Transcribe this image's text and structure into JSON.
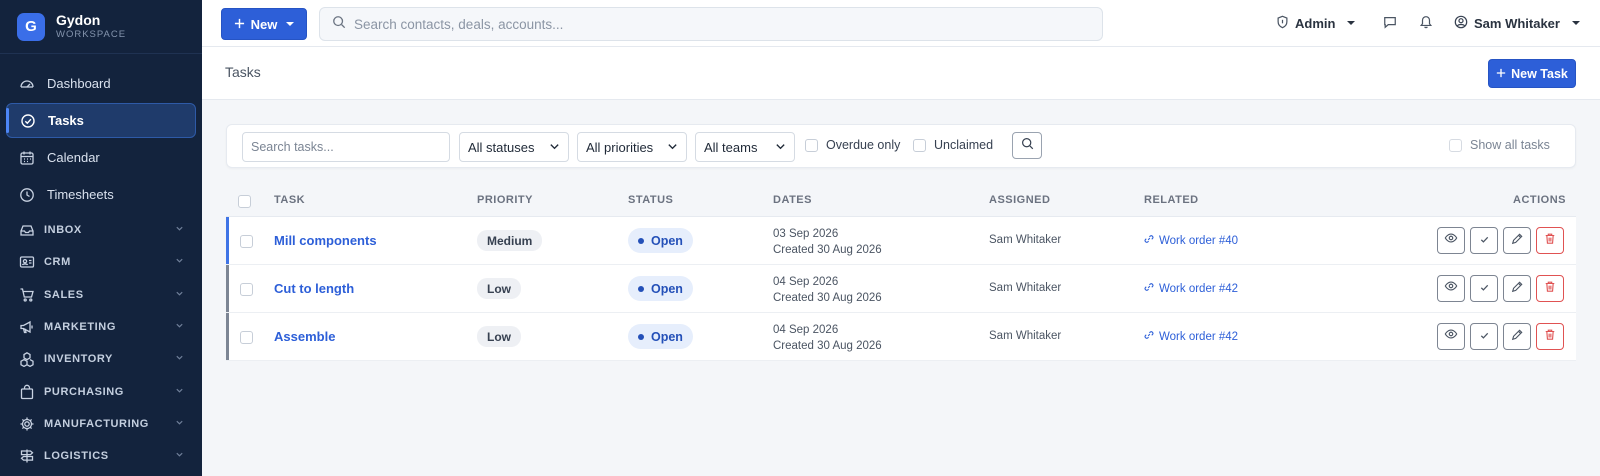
{
  "brand": {
    "logo_letter": "G",
    "name": "Gydon",
    "sub": "WORKSPACE"
  },
  "sidebar": {
    "items": [
      {
        "label": "Dashboard",
        "icon": "gauge-icon",
        "active": false
      },
      {
        "label": "Tasks",
        "icon": "check-circle-icon",
        "active": true
      },
      {
        "label": "Calendar",
        "icon": "calendar-icon",
        "active": false
      },
      {
        "label": "Timesheets",
        "icon": "clock-icon",
        "active": false
      }
    ],
    "groups": [
      {
        "label": "INBOX",
        "icon": "inbox-icon"
      },
      {
        "label": "CRM",
        "icon": "contact-card-icon"
      },
      {
        "label": "SALES",
        "icon": "cart-icon"
      },
      {
        "label": "MARKETING",
        "icon": "megaphone-icon"
      },
      {
        "label": "INVENTORY",
        "icon": "boxes-icon"
      },
      {
        "label": "PURCHASING",
        "icon": "bag-icon"
      },
      {
        "label": "MANUFACTURING",
        "icon": "gear-icon"
      },
      {
        "label": "LOGISTICS",
        "icon": "signpost-icon"
      }
    ]
  },
  "topbar": {
    "new_label": "New",
    "search_placeholder": "Search contacts, deals, accounts...",
    "role_label": "Admin",
    "user_name": "Sam Whitaker"
  },
  "page": {
    "title": "Tasks",
    "new_task_label": "New Task"
  },
  "filters": {
    "search_placeholder": "Search tasks...",
    "status_value": "All statuses",
    "priority_value": "All priorities",
    "team_value": "All teams",
    "overdue_label": "Overdue only",
    "unclaimed_label": "Unclaimed",
    "show_all_label": "Show all tasks"
  },
  "table": {
    "headers": {
      "task": "TASK",
      "priority": "PRIORITY",
      "status": "STATUS",
      "dates": "DATES",
      "assigned": "ASSIGNED",
      "related": "RELATED",
      "actions": "ACTIONS"
    },
    "rows": [
      {
        "task": "Mill components",
        "priority": "Medium",
        "status": "Open",
        "due": "03 Sep 2026",
        "created": "Created 30 Aug 2026",
        "assigned": "Sam Whitaker",
        "related": "Work order #40",
        "accent": "#3f74e6"
      },
      {
        "task": "Cut to length",
        "priority": "Low",
        "status": "Open",
        "due": "04 Sep 2026",
        "created": "Created 30 Aug 2026",
        "assigned": "Sam Whitaker",
        "related": "Work order #42",
        "accent": "#7c8594"
      },
      {
        "task": "Assemble",
        "priority": "Low",
        "status": "Open",
        "due": "04 Sep 2026",
        "created": "Created 30 Aug 2026",
        "assigned": "Sam Whitaker",
        "related": "Work order #42",
        "accent": "#7c8594"
      }
    ]
  },
  "colors": {
    "sidebar_bg": "#13233d",
    "accent": "#2d5fd8",
    "danger": "#e05252"
  }
}
